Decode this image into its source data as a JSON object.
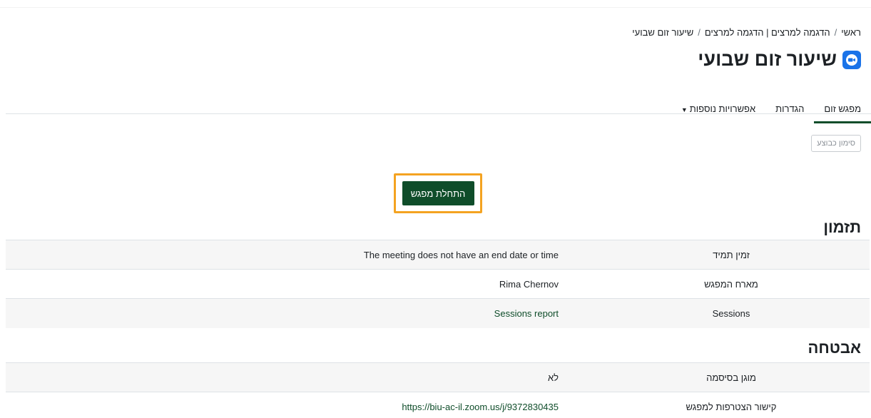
{
  "breadcrumb": {
    "items": [
      "ראשי",
      "הדגמה למרצים | הדגמה למרצים",
      "שיעור זום שבועי"
    ],
    "separator": "/"
  },
  "page": {
    "title": "שיעור זום שבועי",
    "icon": "zoom-video-icon"
  },
  "tabs": [
    {
      "label": "מפגש זום",
      "active": true
    },
    {
      "label": "הגדרות",
      "active": false
    },
    {
      "label": "אפשרויות נוספות",
      "active": false,
      "dropdown": true
    }
  ],
  "actions": {
    "mark_complete": "סימון כבוצע",
    "start_meeting": "התחלת מפגש"
  },
  "schedule": {
    "heading": "תזמון",
    "rows": [
      {
        "label": "זמין תמיד",
        "value": "The meeting does not have an end date or time"
      },
      {
        "label": "מארח המפגש",
        "value": "Rima Chernov"
      },
      {
        "label": "Sessions",
        "value": "Sessions report"
      }
    ]
  },
  "security": {
    "heading": "אבטחה",
    "rows": [
      {
        "label": "מוגן בסיסמה",
        "value": "לא"
      },
      {
        "label": "קישור הצטרפות למפגש",
        "value": "https://biu-ac-il.zoom.us/j/9372830435"
      }
    ]
  },
  "colors": {
    "primary": "#0f4d2a",
    "highlight": "#f4a321",
    "zoom_blue": "#1a73e8"
  }
}
